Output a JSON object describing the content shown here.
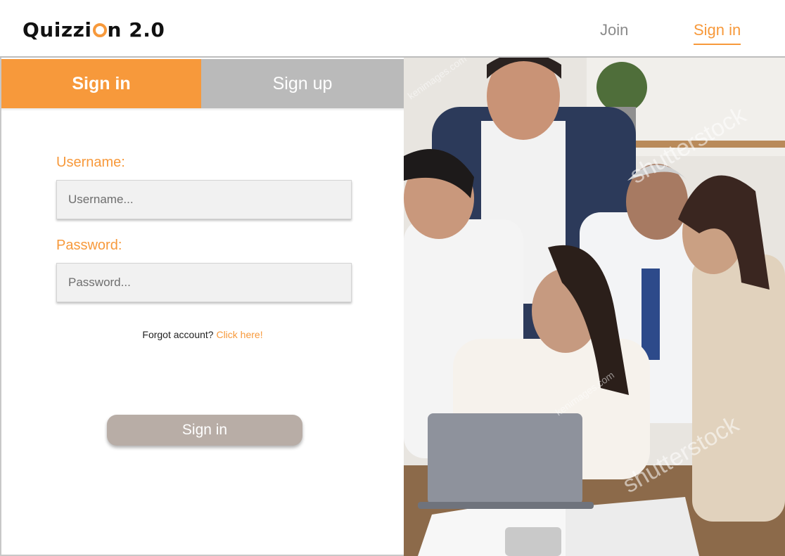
{
  "header": {
    "logo_text_before": "Quizzi",
    "logo_text_after": "n 2.0",
    "nav_join": "Join",
    "nav_signin": "Sign in"
  },
  "tabs": {
    "signin": "Sign in",
    "signup": "Sign up"
  },
  "form": {
    "username_label": "Username:",
    "username_placeholder": "Username...",
    "password_label": "Password:",
    "password_placeholder": "Password...",
    "forgot_text": "Forgot account?",
    "forgot_link": "Click here!",
    "submit_label": "Sign in"
  },
  "photo": {
    "watermark_1": "shutterstock",
    "watermark_2": "kenimages.com"
  },
  "colors": {
    "accent": "#f7993b",
    "tab_inactive": "#bababa",
    "button": "#b8ada6"
  }
}
